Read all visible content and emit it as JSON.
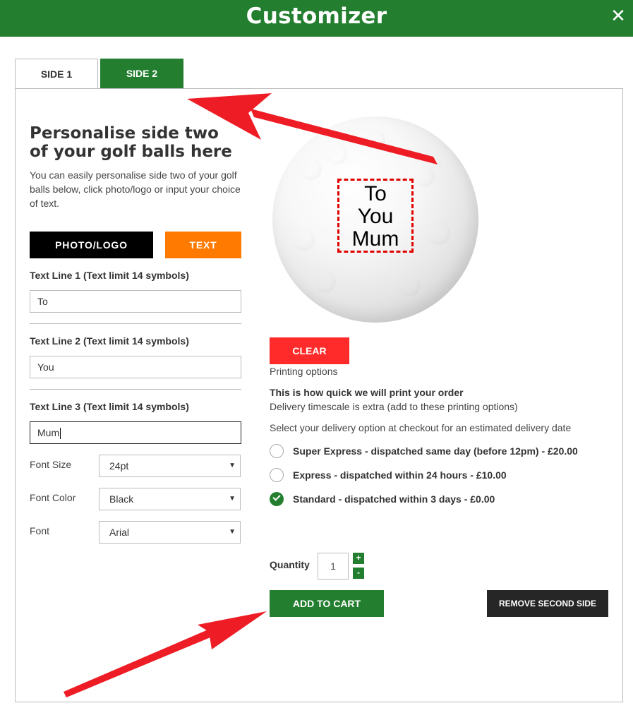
{
  "header": {
    "title": "Customizer",
    "close_glyph": "✕"
  },
  "tabs": [
    {
      "label": "SIDE 1",
      "active": false
    },
    {
      "label": "SIDE 2",
      "active": true
    }
  ],
  "left": {
    "heading": "Personalise side two of your golf balls here",
    "intro": "You can easily personalise side two of your golf balls below, click photo/logo or input your choice of text.",
    "photo_logo_label": "PHOTO/LOGO",
    "text_label": "TEXT",
    "text_lines": [
      {
        "label": "Text Line 1 (Text limit 14 symbols)",
        "value": "To"
      },
      {
        "label": "Text Line 2 (Text limit 14 symbols)",
        "value": "You"
      },
      {
        "label": "Text Line 3 (Text limit 14 symbols)",
        "value": "Mum"
      }
    ],
    "options": {
      "font_size": {
        "label": "Font Size",
        "value": "24pt"
      },
      "font_color": {
        "label": "Font Color",
        "value": "Black"
      },
      "font": {
        "label": "Font",
        "value": "Arial"
      }
    }
  },
  "preview": {
    "lines": [
      "To",
      "You",
      "Mum"
    ]
  },
  "right": {
    "clear_label": "CLEAR",
    "printing_options": "Printing options",
    "quick_title": "This is how quick we will print your order",
    "quick_sub": "Delivery timescale is extra (add to these printing options)",
    "select_delivery": "Select your delivery option at checkout for an estimated delivery date",
    "delivery_options": [
      {
        "label": "Super Express - dispatched same day (before 12pm) - £20.00",
        "checked": false
      },
      {
        "label": "Express - dispatched within 24 hours - £10.00",
        "checked": false
      },
      {
        "label": "Standard - dispatched within 3 days - £0.00",
        "checked": true
      }
    ],
    "quantity_label": "Quantity",
    "quantity_value": "1",
    "qty_plus": "+",
    "qty_minus": "-",
    "add_to_cart": "ADD TO CART",
    "remove_second_side": "REMOVE SECOND SIDE"
  },
  "colors": {
    "brand_green": "#237f2f",
    "text_orange": "#ff7a00",
    "clear_red": "#ff2a2a",
    "annotation_red": "#ee1c25",
    "remove_dark": "#262626"
  }
}
